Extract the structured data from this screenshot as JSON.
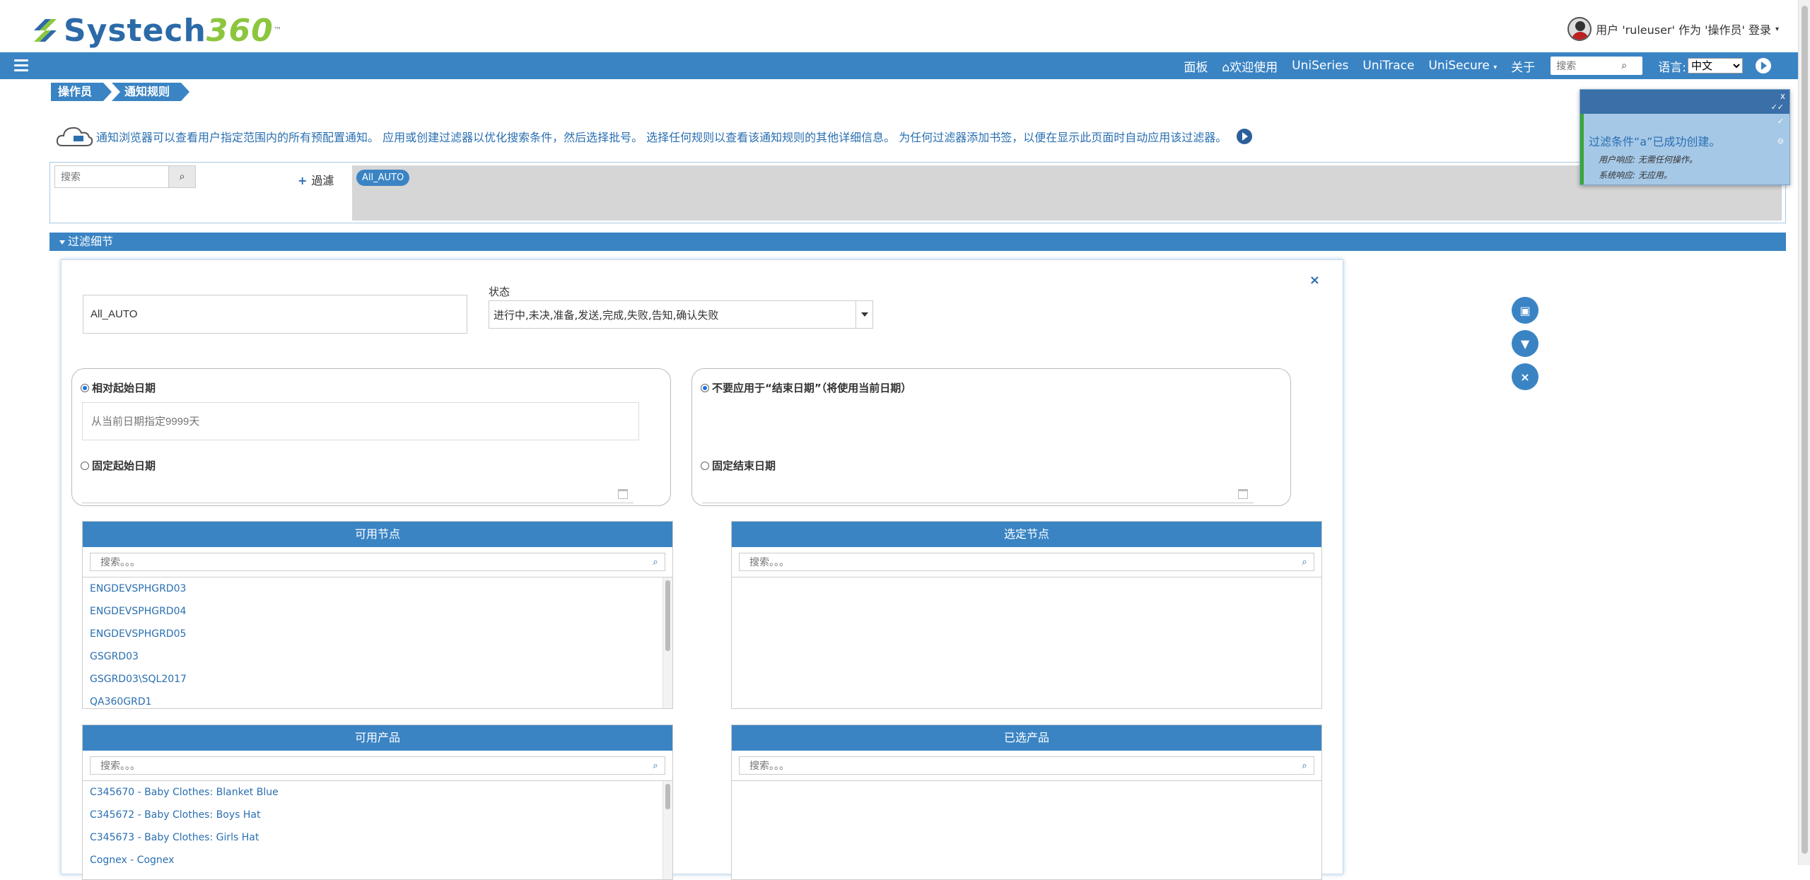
{
  "header": {
    "brand_main": "Systech",
    "brand_num": "360",
    "brand_tm": "™",
    "user_text": "用户 'ruleuser' 作为 '操作员' 登录"
  },
  "nav": {
    "items": [
      "面板",
      "欢迎使用",
      "UniSeries",
      "UniTrace",
      "UniSecure",
      "关于"
    ],
    "search_placeholder": "搜索",
    "lang_label": "语言:",
    "lang_value": "中文"
  },
  "breadcrumb": [
    "操作员",
    "通知规则"
  ],
  "info": {
    "text": "通知浏览器可以查看用户指定范围内的所有预配置通知。 应用或创建过滤器以优化搜索条件，然后选择批号。 选择任何规则以查看该通知规则的其他详细信息。 为任何过滤器添加书签，以便在显示此页面时自动应用该过滤器。"
  },
  "filter": {
    "search_placeholder": "搜索",
    "add_label": "過濾",
    "tag": "All_AUTO"
  },
  "section": {
    "title": "过滤细节"
  },
  "panel": {
    "name_value": "All_AUTO",
    "status_label": "状态",
    "status_value": "进行中,未决,准备,发送,完成,失败,告知,确认失败",
    "relative_start_label": "相对起始日期",
    "relative_start_placeholder": "从当前日期指定9999天",
    "fixed_start_label": "固定起始日期",
    "no_end_label": "不要应用于“结束日期”（将使用当前日期）",
    "fixed_end_label": "固定结束日期"
  },
  "nodes": {
    "available_title": "可用节点",
    "selected_title": "选定节点",
    "search_placeholder": "搜索。。。",
    "available_items": [
      "ENGDEVSPHGRD03",
      "ENGDEVSPHGRD04",
      "ENGDEVSPHGRD05",
      "GSGRD03",
      "GSGRD03\\SQL2017",
      "QA360GRD1"
    ]
  },
  "products": {
    "available_title": "可用产品",
    "selected_title": "已选产品",
    "search_placeholder": "搜索。。。",
    "available_items": [
      "C345670 - Baby Clothes: Blanket Blue",
      "C345672 - Baby Clothes: Boys Hat",
      "C345673 - Baby Clothes: Girls Hat",
      "Cognex - Cognex"
    ]
  },
  "move_buttons": [
    "›",
    "»",
    "‹",
    "«"
  ],
  "toast": {
    "close": "x",
    "title": "过滤条件“a”已成功创建。",
    "user_response": "用户响应: 无需任何操作。",
    "system_response": "系统响应: 无应用。"
  },
  "colors": {
    "primary": "#3a84c4",
    "link": "#2a6fb0",
    "brand_green": "#8cc63f"
  }
}
